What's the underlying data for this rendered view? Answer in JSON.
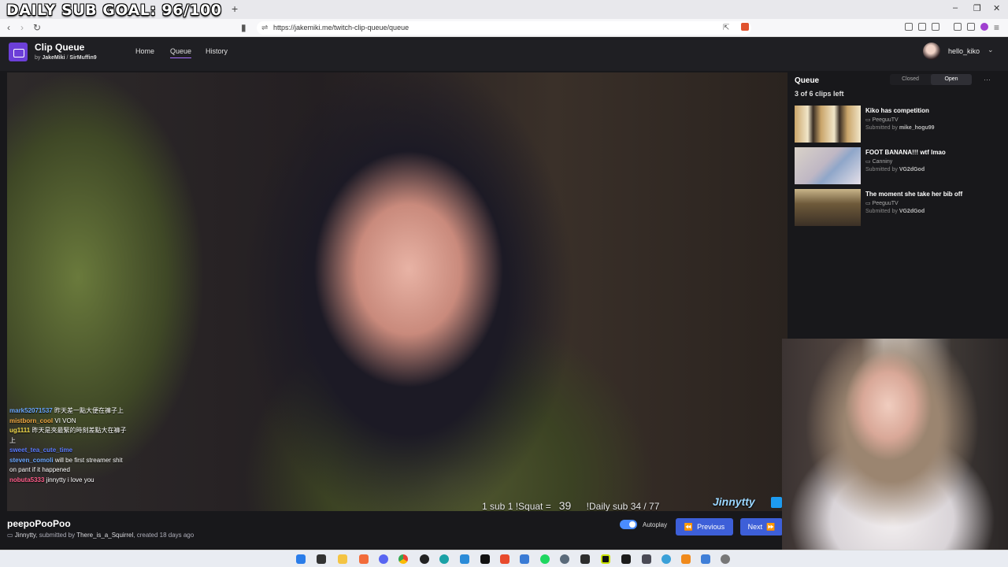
{
  "overlay": {
    "goal_text": "DAILY SUB GOAL: 96/100"
  },
  "browser": {
    "url": "https://jakemiki.me/twitch-clip-queue/queue",
    "tab_close": "×",
    "new_tab": "+",
    "window_controls": [
      "–",
      "❐",
      "✕"
    ]
  },
  "app": {
    "title": "Clip Queue",
    "by_prefix": "by",
    "author1": "JakeMiki",
    "separator": "/",
    "author2": "SirMuffin9",
    "nav": [
      "Home",
      "Queue",
      "History"
    ],
    "active_nav": "Queue",
    "username": "hello_kiko"
  },
  "stream_overlay": {
    "squat_label": "1 sub 1 !Squat =",
    "squat_value": "39",
    "daily_label": "!Daily sub",
    "daily_value": "34 / 77",
    "brand": "Jinnytty"
  },
  "chat": [
    {
      "user": "mark52071537",
      "msg": "昨天差一點大便在褲子上",
      "color": "#6aa7ff"
    },
    {
      "user": "mistborn_cool",
      "msg": "VI VON",
      "color": "#f0a640"
    },
    {
      "user": "ug1111",
      "msg": "昨天是夾最緊的時刻差點大在褲子上",
      "color": "#f2d94a"
    },
    {
      "user": "sweet_tea_cute_time",
      "msg": "",
      "color": "#5b7bff"
    },
    {
      "user": "steven_comoli",
      "msg": "will be first streamer shit on pant if it happened",
      "color": "#6aa7ff"
    },
    {
      "user": "nobuta5333",
      "msg": "jinnytty i love you",
      "color": "#ff5d8a"
    }
  ],
  "clip": {
    "title": "peepoPooPoo",
    "channel": "Jinnytty",
    "submitted_by_label": ", submitted by",
    "submitter": "There_is_a_Squirrel",
    "created": ", created 18 days ago"
  },
  "controls": {
    "autoplay_label": "Autoplay",
    "autoplay_on": true,
    "previous": "Previous",
    "next": "Next"
  },
  "queue": {
    "title": "Queue",
    "count": "3 of 6 clips left",
    "toggle": [
      "Closed",
      "Open"
    ],
    "active_toggle": "Open",
    "more": "···",
    "items": [
      {
        "title": "Kiko has competition",
        "channel": "PeeguuTV",
        "submitted_label": "Submitted by",
        "submitter": "mike_hogu99",
        "thumb_colors": [
          "#caa56a",
          "#f1e6c9"
        ]
      },
      {
        "title": "FOOT BANANA!!! wtf lmao",
        "channel": "Canniny",
        "submitted_label": "Submitted by",
        "submitter": "VG2dGod",
        "thumb_colors": [
          "#d9d2c8",
          "#8fa6c9"
        ]
      },
      {
        "title": "The moment she take her bib off",
        "channel": "PeeguuTV",
        "submitted_label": "Submitted by",
        "submitter": "VG2dGod",
        "thumb_colors": [
          "#6e5a3a",
          "#c9b58a"
        ]
      }
    ]
  },
  "taskbar_icons": [
    "windows",
    "taskview",
    "folder",
    "brave",
    "discord",
    "chrome",
    "obs",
    "edge",
    "vscode",
    "capcut",
    "brave-red",
    "notes",
    "spotify",
    "steam",
    "terminal",
    "gpu",
    "cmd",
    "calc",
    "globe",
    "vlc",
    "photos",
    "settings"
  ]
}
